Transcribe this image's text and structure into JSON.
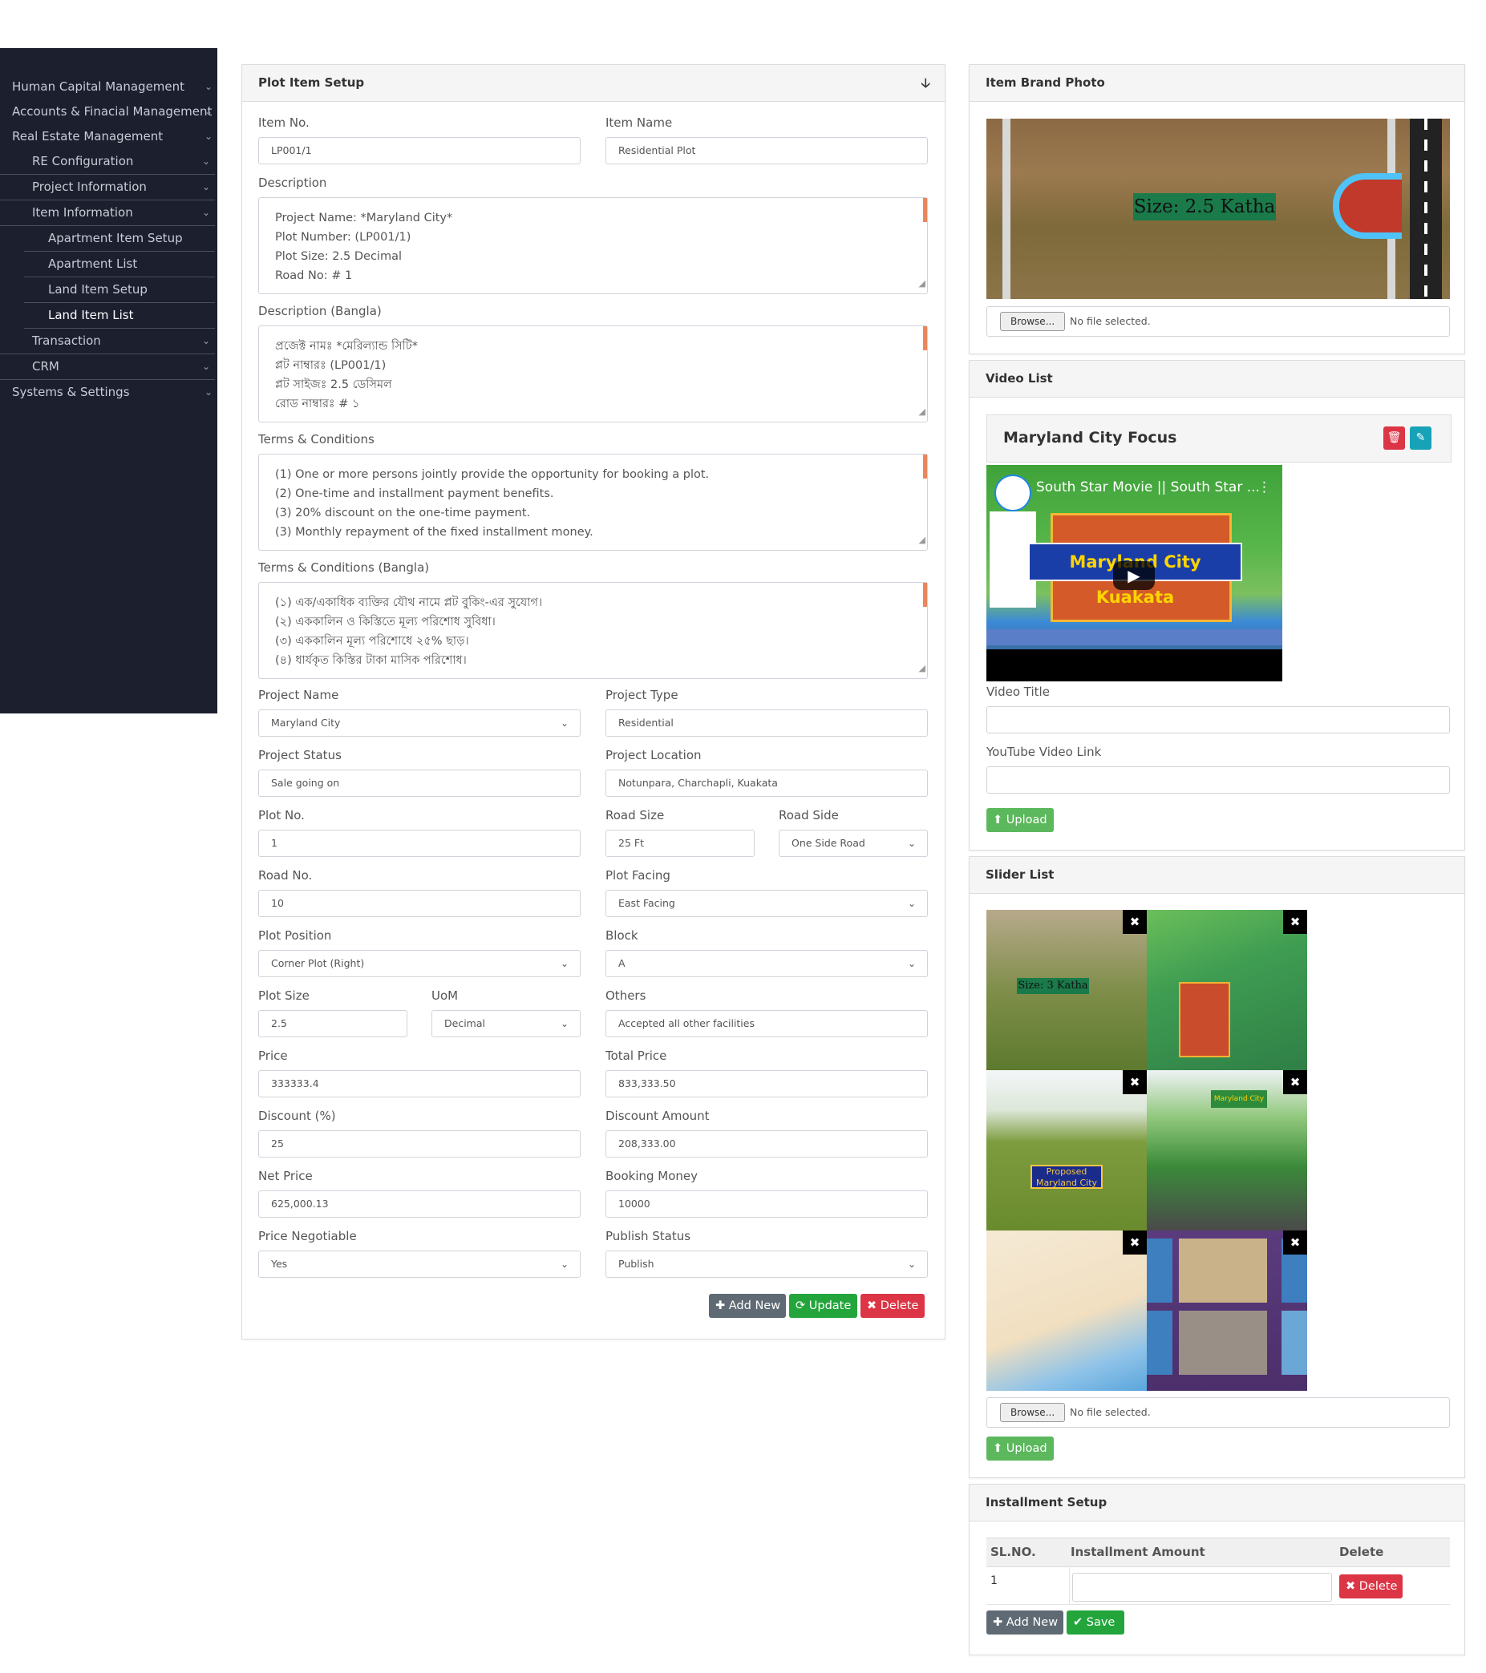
{
  "sidebar": {
    "items": [
      {
        "label": "Human Capital Management"
      },
      {
        "label": "Accounts & Finacial Management"
      },
      {
        "label": "Real Estate Management"
      },
      {
        "label": "RE Configuration"
      },
      {
        "label": "Project Information"
      },
      {
        "label": "Item Information"
      },
      {
        "label": "Apartment Item Setup"
      },
      {
        "label": "Apartment List"
      },
      {
        "label": "Land Item Setup"
      },
      {
        "label": "Land Item List"
      },
      {
        "label": "Transaction"
      },
      {
        "label": "CRM"
      },
      {
        "label": "Systems & Settings"
      }
    ]
  },
  "plot_setup": {
    "title": "Plot Item Setup",
    "item_no": {
      "label": "Item No.",
      "value": "LP001/1"
    },
    "item_name": {
      "label": "Item Name",
      "value": "Residential Plot"
    },
    "description": {
      "label": "Description",
      "lines": [
        "Project Name: *Maryland City*",
        "Plot Number: (LP001/1)",
        "Plot Size: 2.5 Decimal",
        "Road No: # 1"
      ]
    },
    "description_bangla": {
      "label": "Description (Bangla)",
      "lines": [
        "প্রজেক্ট নামঃ *মেরিল্যান্ড সিটি*",
        "প্লট নাম্বারঃ (LP001/1)",
        "প্লট সাইজঃ 2.5 ডেসিমল",
        "রোড নাম্বারঃ # ১"
      ]
    },
    "terms": {
      "label": "Terms & Conditions",
      "lines": [
        "(1) One or more persons jointly provide the opportunity for booking a plot.",
        "(2) One-time and installment payment benefits.",
        "(3) 20% discount on the one-time payment.",
        "(3) Monthly repayment of the fixed installment money."
      ]
    },
    "terms_bangla": {
      "label": "Terms & Conditions (Bangla)",
      "lines": [
        "(১) এক/একাধিক ব্যক্তির যৌথ নামে প্লট বুকিং-এর সুযোগ।",
        "(২)    এককালিন ও কিস্তিতে মূল্য পরিশোধ সুবিধা।",
        "(৩)    এককালিন মূল্য পরিশোধে ২৫% ছাড়।",
        "(৪)    ধার্যকৃত কিস্তির টাকা মাসিক পরিশোধ।"
      ]
    },
    "project_name": {
      "label": "Project Name",
      "value": "Maryland City"
    },
    "project_type": {
      "label": "Project Type",
      "value": "Residential"
    },
    "project_status": {
      "label": "Project Status",
      "value": "Sale going on"
    },
    "project_location": {
      "label": "Project Location",
      "value": "Notunpara, Charchapli, Kuakata"
    },
    "plot_no": {
      "label": "Plot No.",
      "value": "1"
    },
    "road_size": {
      "label": "Road Size",
      "value": "25 Ft"
    },
    "road_side": {
      "label": "Road Side",
      "value": "One Side Road"
    },
    "road_no": {
      "label": "Road No.",
      "value": "10"
    },
    "plot_facing": {
      "label": "Plot Facing",
      "value": "East Facing"
    },
    "plot_position": {
      "label": "Plot Position",
      "value": "Corner Plot (Right)"
    },
    "block": {
      "label": "Block",
      "value": "A"
    },
    "plot_size": {
      "label": "Plot Size",
      "value": "2.5"
    },
    "uom": {
      "label": "UoM",
      "value": "Decimal"
    },
    "others": {
      "label": "Others",
      "value": "Accepted all other facilities"
    },
    "price": {
      "label": "Price",
      "value": "333333.4"
    },
    "total_price": {
      "label": "Total Price",
      "value": "833,333.50"
    },
    "discount": {
      "label": "Discount (%)",
      "value": "25"
    },
    "discount_amount": {
      "label": "Discount Amount",
      "value": "208,333.00"
    },
    "net_price": {
      "label": "Net Price",
      "value": "625,000.13"
    },
    "booking_money": {
      "label": "Booking Money",
      "value": "10000"
    },
    "price_negotiable": {
      "label": "Price Negotiable",
      "value": "Yes"
    },
    "publish_status": {
      "label": "Publish Status",
      "value": "Publish"
    },
    "buttons": {
      "add_new": "Add New",
      "update": "Update",
      "delete": "Delete"
    }
  },
  "brand_photo": {
    "title": "Item Brand Photo",
    "sign_text": "Size: 2.5 Katha",
    "browse": "Browse...",
    "no_file": "No file selected."
  },
  "video_list": {
    "title": "Video List",
    "card_title": "Maryland City Focus",
    "thumb_title": "South Star Movie || South Star ...",
    "thumb_banner": "Maryland City Kuakata",
    "video_title_label": "Video Title",
    "video_title_value": "",
    "link_label": "YouTube Video Link",
    "link_value": "",
    "upload": "Upload"
  },
  "slider_list": {
    "title": "Slider List",
    "slide_texts": [
      "Size: 3 Katha",
      "Proposed Maryland City",
      "Maryland City"
    ],
    "browse": "Browse...",
    "no_file": "No file selected.",
    "upload": "Upload"
  },
  "installment": {
    "title": "Installment Setup",
    "headers": [
      "SL.NO.",
      "Installment Amount",
      "Delete"
    ],
    "rows": [
      {
        "sl": "1",
        "amount": ""
      }
    ],
    "delete": "Delete",
    "add_new": "Add New",
    "save": "Save"
  },
  "colors": {
    "sidebar_bg": "#1b1f2e",
    "primary_gray": "#5f6a74",
    "success": "#23a53c",
    "danger": "#dc3545",
    "info": "#17a2b8",
    "light_success": "#5cb85c",
    "scroll_accent": "#e8875e"
  }
}
